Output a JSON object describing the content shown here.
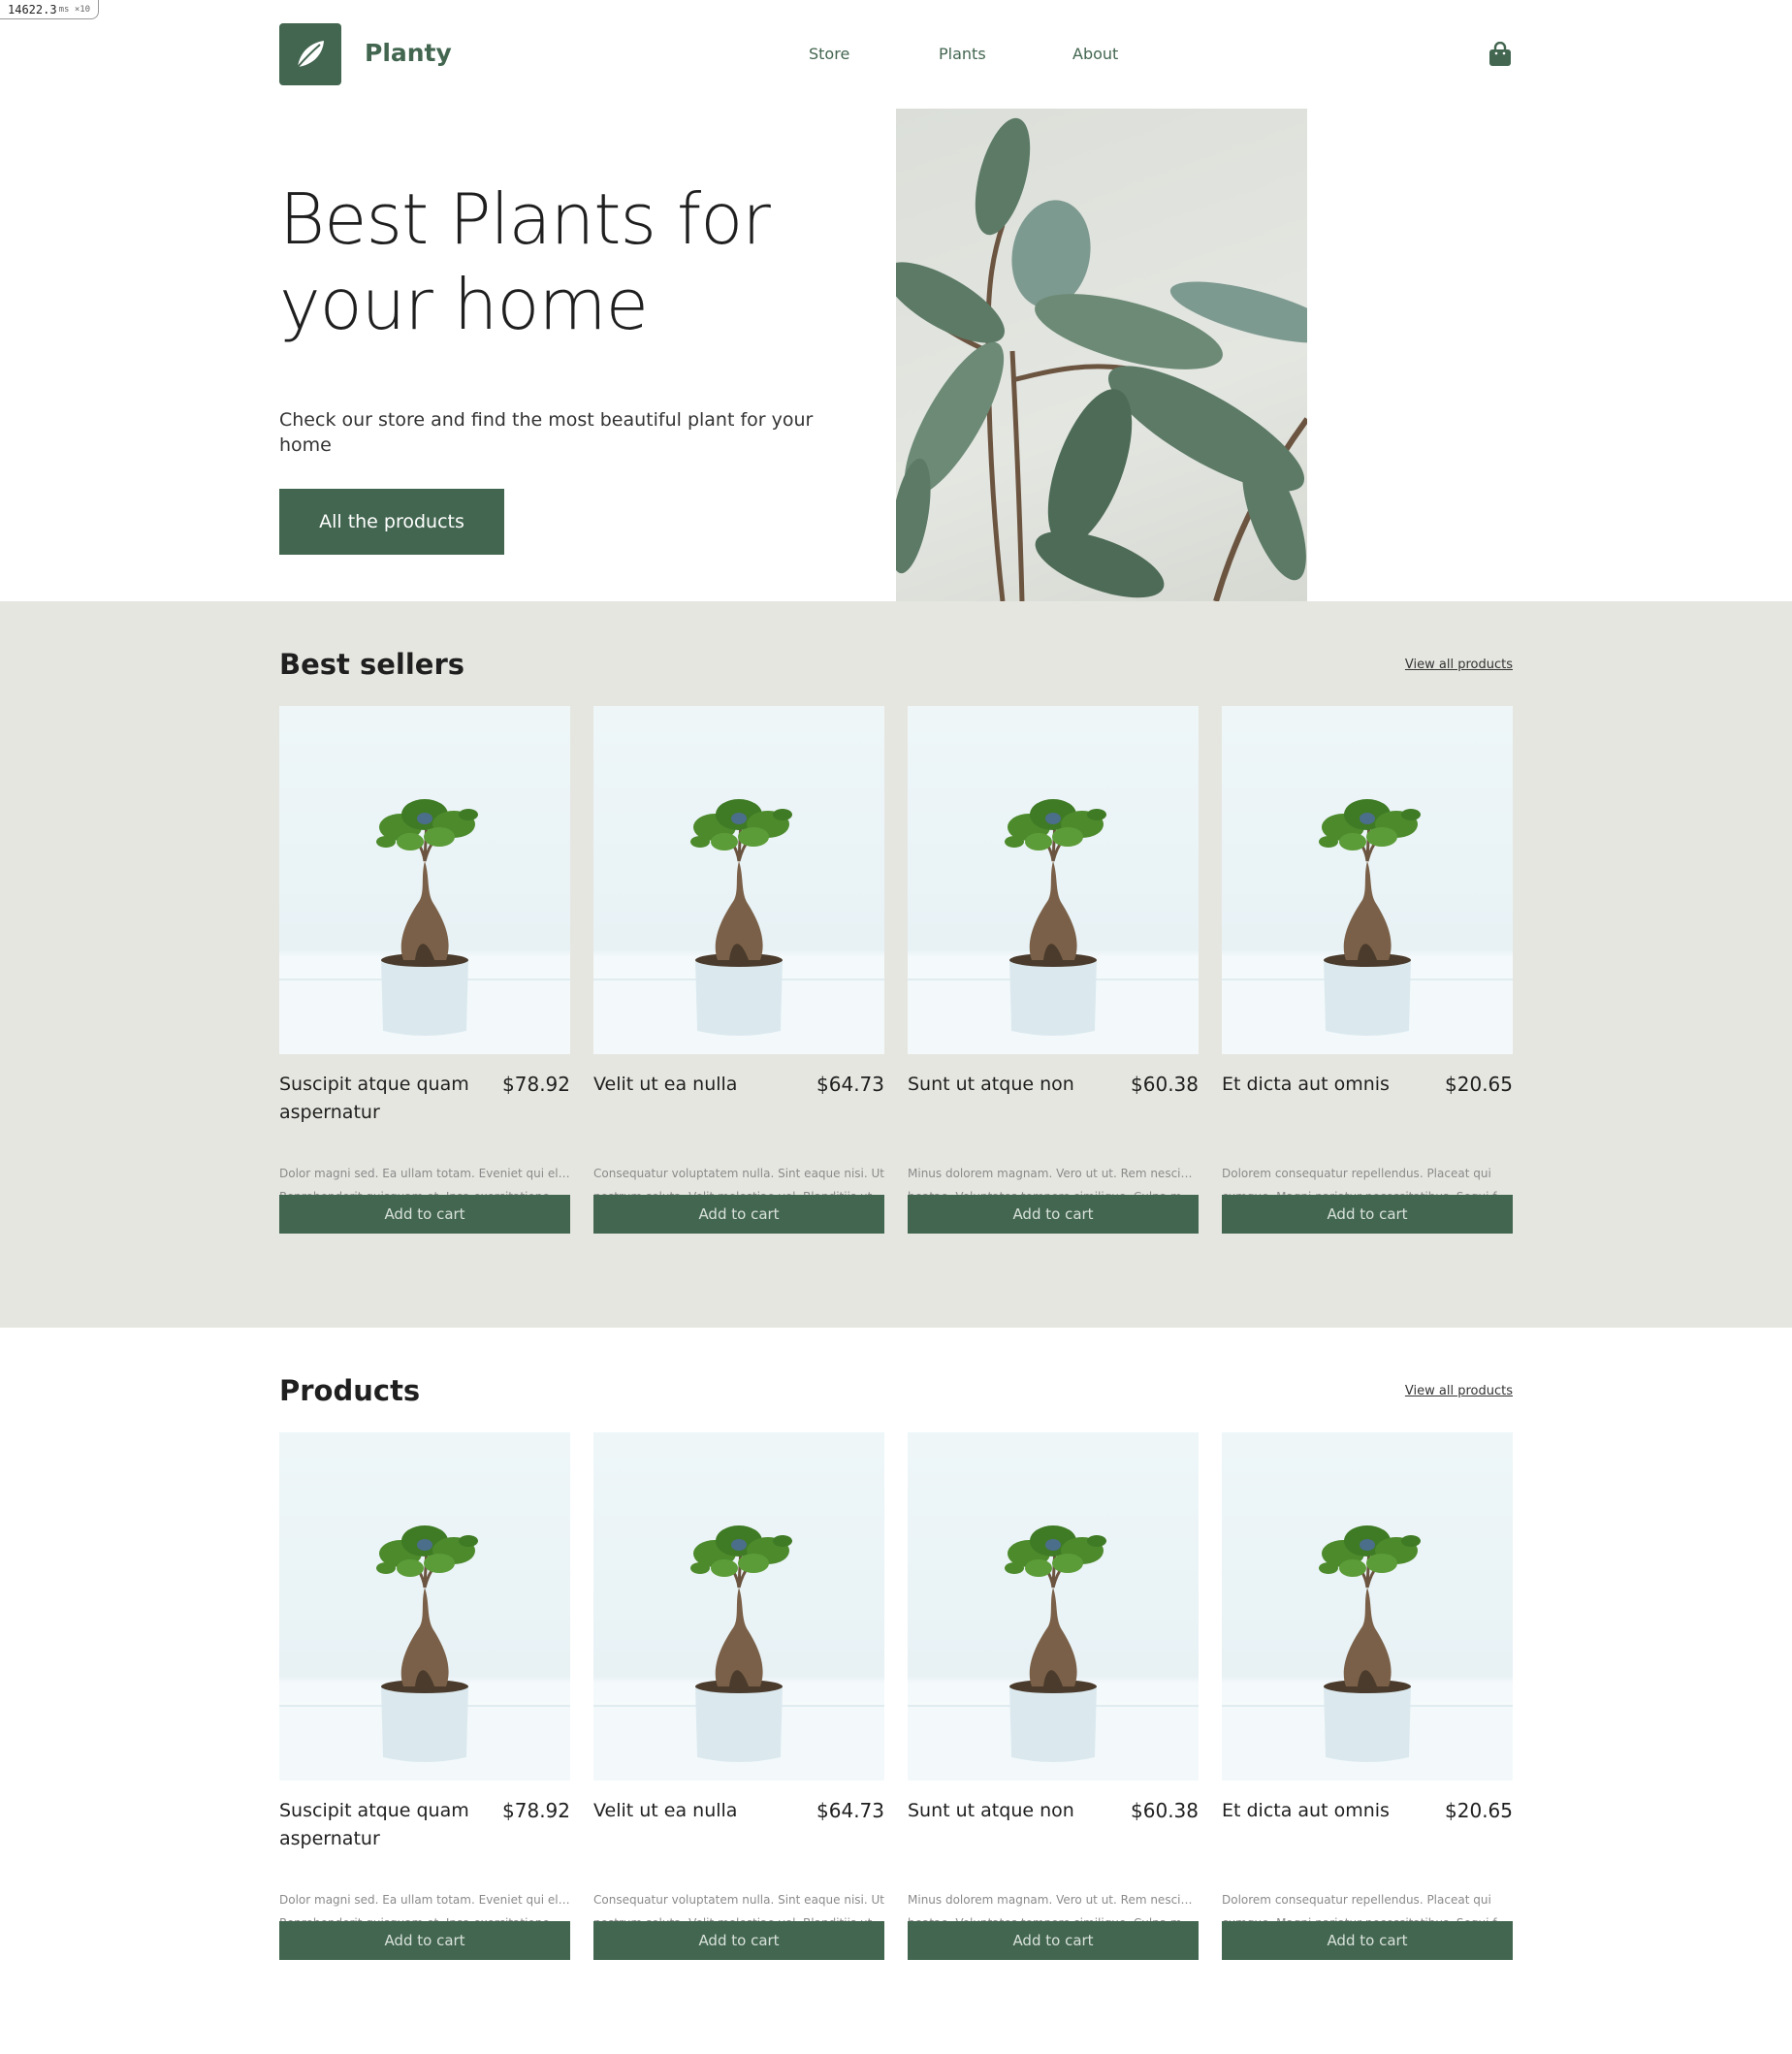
{
  "perf": {
    "value": "14622.3",
    "unit": "ms ×10"
  },
  "brand": {
    "name": "Planty",
    "color": "#436650"
  },
  "nav": {
    "items": [
      "Store",
      "Plants",
      "About"
    ]
  },
  "cart": {
    "icon": "shopping-bag-icon"
  },
  "hero": {
    "title": "Best Plants for your home",
    "subtitle": "Check our store and find the most beautiful plant for your home",
    "button": "All the products"
  },
  "best_sellers": {
    "title": "Best sellers",
    "view_all": "View all products",
    "background": "#e6e6e1"
  },
  "products": {
    "title": "Products",
    "view_all": "View all products"
  },
  "items": [
    {
      "name": "Suscipit atque quam aspernatur",
      "price": "$78.92",
      "desc1": "Dolor magni sed. Ea ullam totam. Eveniet qui eligendi.",
      "desc2": "Reprehenderit quisquam et. Ipsa exercitationem veli...",
      "button": "Add to cart"
    },
    {
      "name": "Velit ut ea nulla",
      "price": "$64.73",
      "desc1": "Consequatur voluptatem nulla. Sint eaque nisi. Ut",
      "desc2": "nostrum soluta. Velit molestiae vel. Blanditiis ut culpa...",
      "button": "Add to cart"
    },
    {
      "name": "Sunt ut atque non",
      "price": "$60.38",
      "desc1": "Minus dolorem magnam. Vero ut ut. Rem nesciunt",
      "desc2": "beatae. Voluptates tempore similique. Culpa molestia...",
      "button": "Add to cart"
    },
    {
      "name": "Et dicta aut omnis",
      "price": "$20.65",
      "desc1": "Dolorem consequatur repellendus. Placeat qui",
      "desc2": "cumque. Magni pariatur necessitatibus. Sequi facere...",
      "button": "Add to cart"
    }
  ]
}
